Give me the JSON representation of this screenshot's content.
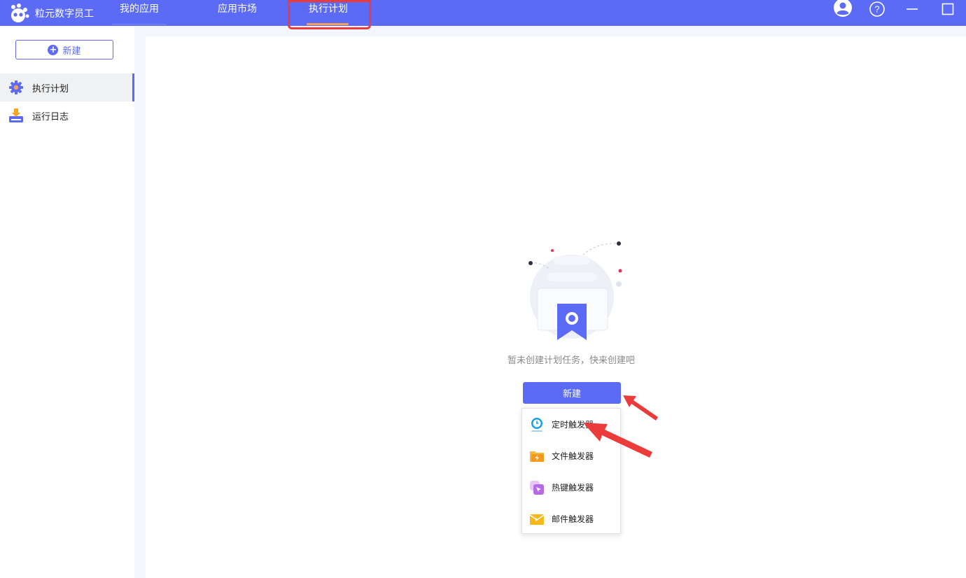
{
  "app": {
    "name": "粒元数字员工"
  },
  "nav": {
    "tabs": [
      {
        "label": "我的应用"
      },
      {
        "label": "应用市场"
      },
      {
        "label": "执行计划"
      }
    ]
  },
  "window_controls": {
    "user": "user-icon",
    "help": "help-icon",
    "minimize": "minimize-icon",
    "maximize": "maximize-icon"
  },
  "sidebar": {
    "new_label": "新建",
    "items": [
      {
        "label": "执行计划",
        "icon": "gear-icon",
        "active": true
      },
      {
        "label": "运行日志",
        "icon": "download-tray-icon",
        "active": false
      }
    ]
  },
  "main": {
    "empty_text": "暂未创建计划任务，快来创建吧",
    "new_button": "新建",
    "dropdown": [
      {
        "label": "定时触发器",
        "icon": "clock-icon"
      },
      {
        "label": "文件触发器",
        "icon": "folder-lightning-icon"
      },
      {
        "label": "热键触发器",
        "icon": "hotkey-cursor-icon"
      },
      {
        "label": "邮件触发器",
        "icon": "mail-icon"
      }
    ]
  },
  "colors": {
    "primary": "#5b6bf5",
    "highlight": "#ec3b3b",
    "underline": "#f6a15b"
  }
}
